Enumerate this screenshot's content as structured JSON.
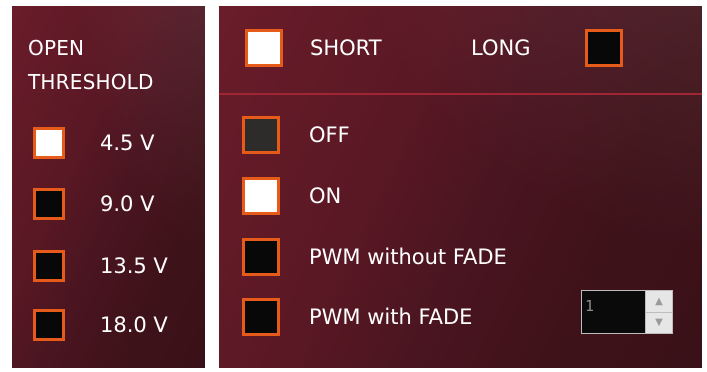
{
  "threshold": {
    "title_line1": "OPEN",
    "title_line2": "THRESHOLD",
    "options": [
      {
        "label": "4.5 V",
        "checked": true
      },
      {
        "label": "9.0 V",
        "checked": false
      },
      {
        "label": "13.5 V",
        "checked": false
      },
      {
        "label": "18.0 V",
        "checked": false
      }
    ]
  },
  "mode": {
    "short_label": "SHORT",
    "short_checked": true,
    "long_label": "LONG",
    "long_checked": false
  },
  "output": {
    "options": [
      {
        "label": "OFF",
        "state": "indeterminate"
      },
      {
        "label": "ON",
        "checked": true
      },
      {
        "label": "PWM without FADE",
        "checked": false
      },
      {
        "label": "PWM with FADE",
        "checked": false
      }
    ],
    "fade_value": "1"
  },
  "colors": {
    "accent": "#e65a1a",
    "panel": "#4a1520",
    "divider": "#a12533"
  }
}
